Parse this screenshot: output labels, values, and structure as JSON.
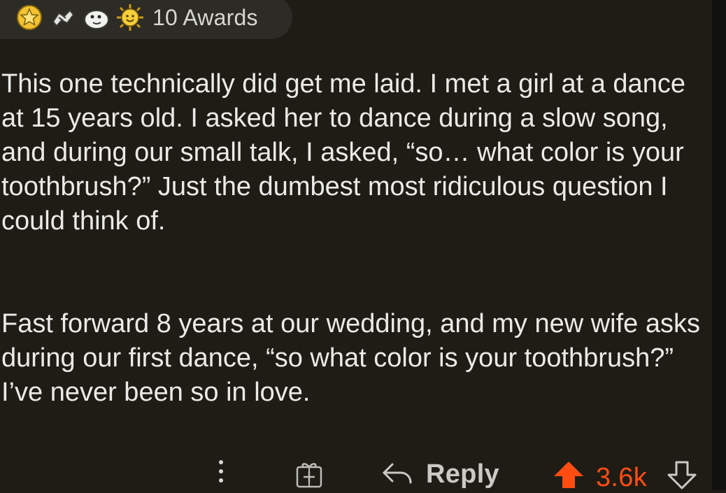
{
  "awards": {
    "icons": [
      "star-award-icon",
      "handshake-award-icon",
      "seal-award-icon",
      "sun-face-award-icon"
    ],
    "label": "10 Awards"
  },
  "comment": {
    "paragraphs": [
      "This one technically did get me laid. I met a girl at a dance at 15 years old. I asked her to dance during a slow song, and during our small talk, I asked, “so… what color is your toothbrush?” Just the dumbest most ridiculous question I could think of.",
      "Fast forward 8 years at our wedding, and my new wife asks during our first dance, “so what color is your toothbrush?” I’ve never been so in love."
    ]
  },
  "actions": {
    "more_icon": "vertical-dots-icon",
    "gift_icon": "gift-icon",
    "reply_icon": "reply-arrow-icon",
    "reply_label": "Reply",
    "upvote_icon": "upvote-arrow-icon",
    "score": "3.6k",
    "downvote_icon": "downvote-arrow-icon"
  },
  "colors": {
    "background": "#1e1c15",
    "text": "#eaeae7",
    "upvote_accent": "#ff4d12",
    "award_pill": "#2d2b25"
  }
}
